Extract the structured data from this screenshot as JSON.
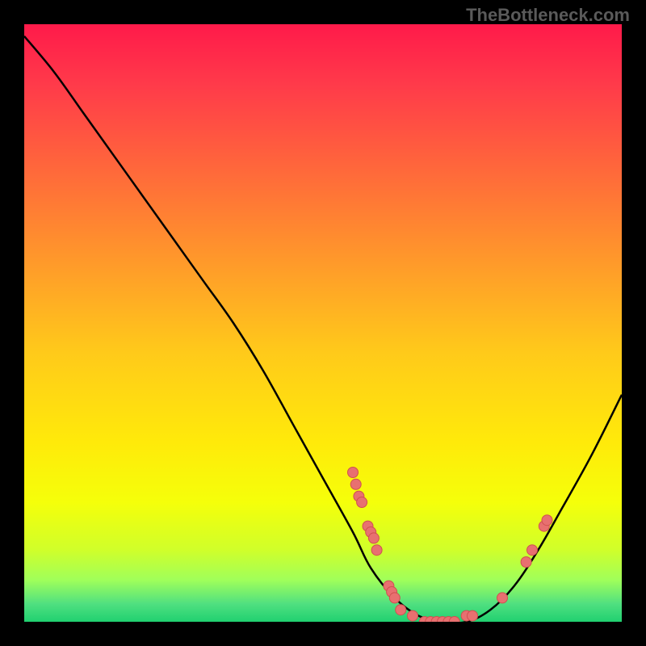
{
  "watermark": "TheBottleneck.com",
  "chart_data": {
    "type": "line",
    "title": "",
    "xlabel": "",
    "ylabel": "",
    "xlim": [
      0,
      100
    ],
    "ylim": [
      0,
      100
    ],
    "curve": {
      "x": [
        0,
        5,
        10,
        15,
        20,
        25,
        30,
        35,
        40,
        45,
        50,
        55,
        58,
        62,
        66,
        70,
        74,
        78,
        82,
        86,
        90,
        95,
        100
      ],
      "y": [
        98,
        92,
        85,
        78,
        71,
        64,
        57,
        50,
        42,
        33,
        24,
        15,
        9,
        4,
        1,
        0,
        0,
        2,
        6,
        12,
        19,
        28,
        38
      ]
    },
    "points": [
      {
        "x": 55,
        "y": 25
      },
      {
        "x": 55.5,
        "y": 23
      },
      {
        "x": 56,
        "y": 21
      },
      {
        "x": 56.5,
        "y": 20
      },
      {
        "x": 57.5,
        "y": 16
      },
      {
        "x": 58,
        "y": 15
      },
      {
        "x": 58.5,
        "y": 14
      },
      {
        "x": 59,
        "y": 12
      },
      {
        "x": 61,
        "y": 6
      },
      {
        "x": 61.5,
        "y": 5
      },
      {
        "x": 62,
        "y": 4
      },
      {
        "x": 63,
        "y": 2
      },
      {
        "x": 65,
        "y": 1
      },
      {
        "x": 67,
        "y": 0
      },
      {
        "x": 68,
        "y": 0
      },
      {
        "x": 69,
        "y": 0
      },
      {
        "x": 70,
        "y": 0
      },
      {
        "x": 71,
        "y": 0
      },
      {
        "x": 72,
        "y": 0
      },
      {
        "x": 74,
        "y": 1
      },
      {
        "x": 75,
        "y": 1
      },
      {
        "x": 80,
        "y": 4
      },
      {
        "x": 84,
        "y": 10
      },
      {
        "x": 85,
        "y": 12
      },
      {
        "x": 87,
        "y": 16
      },
      {
        "x": 87.5,
        "y": 17
      }
    ],
    "background_gradient": {
      "top": "#ff1a4a",
      "middle": "#ffea0a",
      "bottom": "#20d070"
    }
  }
}
